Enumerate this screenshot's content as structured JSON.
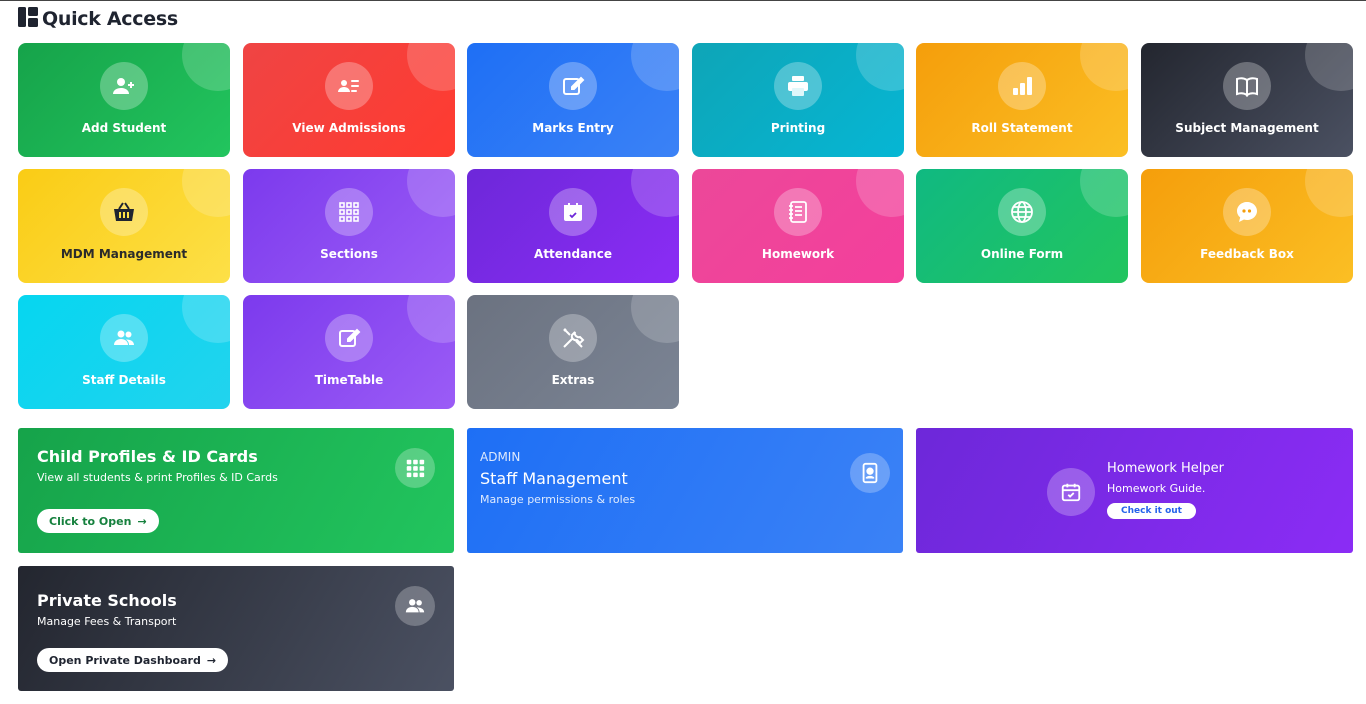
{
  "header": {
    "title": "Quick Access",
    "icon": "dashboard-icon"
  },
  "tiles": [
    {
      "label": "Add Student",
      "icon": "user-plus-icon",
      "gradient": [
        "#16a34a",
        "#22c55e"
      ]
    },
    {
      "label": "View Admissions",
      "icon": "id-list-icon",
      "gradient": [
        "#ef4444",
        "#ff3b30"
      ]
    },
    {
      "label": "Marks Entry",
      "icon": "edit-icon",
      "gradient": [
        "#1e6ff5",
        "#3b82f6"
      ]
    },
    {
      "label": "Printing",
      "icon": "printer-icon",
      "gradient": [
        "#0ea5b7",
        "#06b6d4"
      ]
    },
    {
      "label": "Roll Statement",
      "icon": "bar-chart-icon",
      "gradient": [
        "#f59e0b",
        "#fbbf24"
      ]
    },
    {
      "label": "Subject Management",
      "icon": "book-icon",
      "gradient": [
        "#23262f",
        "#4b5162"
      ]
    },
    {
      "label": "MDM Management",
      "icon": "basket-icon",
      "gradient": [
        "#facc15",
        "#fde047"
      ]
    },
    {
      "label": "Sections",
      "icon": "grid-icon",
      "gradient": [
        "#7c3aed",
        "#9b5cf6"
      ]
    },
    {
      "label": "Attendance",
      "icon": "calendar-check-icon",
      "gradient": [
        "#6d28d9",
        "#8b2cf5"
      ]
    },
    {
      "label": "Homework",
      "icon": "notebook-icon",
      "gradient": [
        "#ec4899",
        "#f43f9c"
      ]
    },
    {
      "label": "Online Form",
      "icon": "globe-icon",
      "gradient": [
        "#10b981",
        "#22c55e"
      ]
    },
    {
      "label": "Feedback Box",
      "icon": "chat-quote-icon",
      "gradient": [
        "#f59e0b",
        "#fbbf24"
      ]
    },
    {
      "label": "Staff Details",
      "icon": "users-icon",
      "gradient": [
        "#06d6f0",
        "#22d3ee"
      ]
    },
    {
      "label": "TimeTable",
      "icon": "edit-icon",
      "gradient": [
        "#7c3aed",
        "#9b5cf6"
      ]
    },
    {
      "label": "Extras",
      "icon": "tools-icon",
      "gradient": [
        "#6b7280",
        "#7b8494"
      ]
    }
  ],
  "cards": {
    "child_profiles": {
      "title": "Child Profiles & ID Cards",
      "subtitle": "View all students & print Profiles & ID Cards",
      "button": "Click to Open",
      "icon": "grid-icon",
      "gradient": [
        "#16a34a",
        "#22c55e"
      ],
      "button_color": "#15803d"
    },
    "staff_management": {
      "eyebrow": "ADMIN",
      "title": "Staff Management",
      "subtitle": "Manage permissions & roles",
      "icon": "id-badge-icon",
      "gradient": [
        "#1e6ff5",
        "#3b82f6"
      ]
    },
    "homework_helper": {
      "title": "Homework Helper",
      "subtitle": "Homework Guide.",
      "button": "Check it out",
      "icon": "calendar-check-icon",
      "gradient": [
        "#6d28d9",
        "#8b2cf5"
      ],
      "button_color": "#2563eb"
    },
    "private_schools": {
      "title": "Private Schools",
      "subtitle": "Manage Fees & Transport",
      "button": "Open Private Dashboard",
      "icon": "users-icon",
      "gradient": [
        "#23262f",
        "#4b5162"
      ],
      "button_color": "#1f2430"
    }
  }
}
